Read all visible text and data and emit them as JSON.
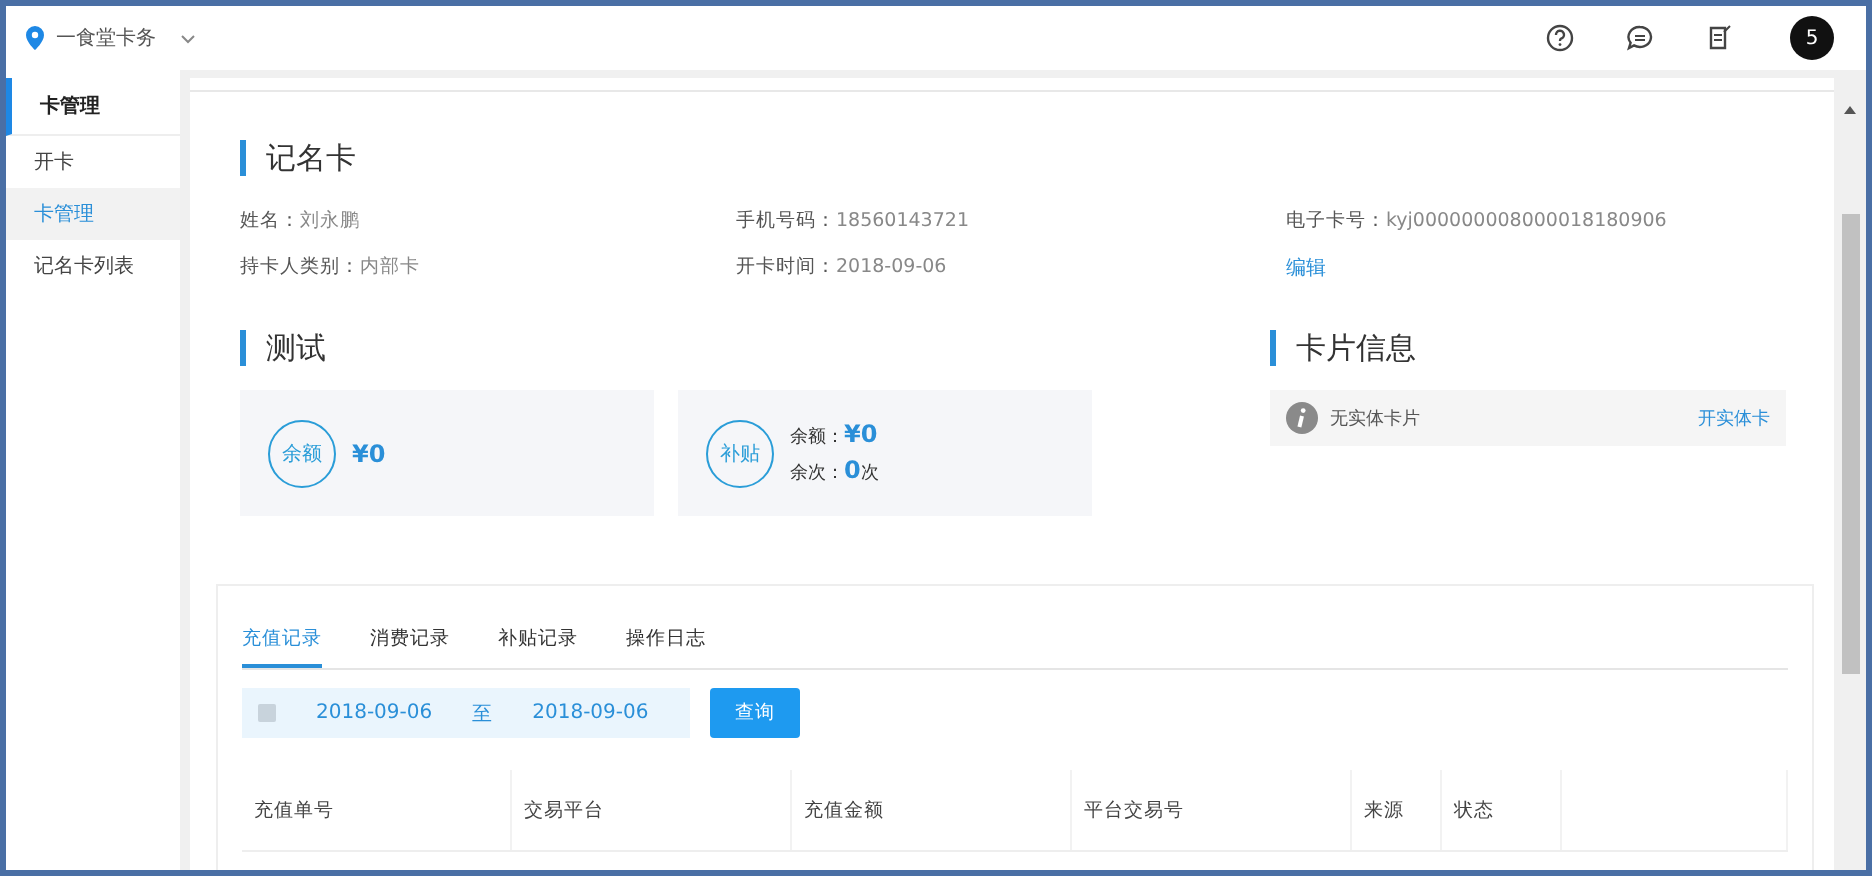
{
  "topbar": {
    "store": "一食堂卡务",
    "avatar": "5"
  },
  "sidebar": {
    "title": "卡管理",
    "items": [
      {
        "label": "开卡",
        "selected": false
      },
      {
        "label": "卡管理",
        "selected": true
      },
      {
        "label": "记名卡列表",
        "selected": false
      }
    ]
  },
  "card_section": {
    "title": "记名卡",
    "fields": [
      {
        "label": "姓名：",
        "value": "刘永鹏"
      },
      {
        "label": "手机号码：",
        "value": "18560143721"
      },
      {
        "label": "电子卡号：",
        "value": "kyj000000008000018180906"
      },
      {
        "label": "持卡人类别：",
        "value": "内部卡"
      },
      {
        "label": "开卡时间：",
        "value": "2018-09-06"
      }
    ],
    "edit_link": "编辑"
  },
  "account_section": {
    "title": "测试",
    "balance": {
      "badge": "余额",
      "amount": "¥0"
    },
    "subsidy": {
      "badge": "补贴",
      "rows": [
        {
          "label": "余额：",
          "value": "¥0",
          "unit": ""
        },
        {
          "label": "余次：",
          "value": "0",
          "unit": "次"
        }
      ]
    }
  },
  "card_info": {
    "title": "卡片信息",
    "message": "无实体卡片",
    "action": "开实体卡"
  },
  "records": {
    "tabs": [
      {
        "label": "充值记录",
        "selected": true
      },
      {
        "label": "消费记录",
        "selected": false
      },
      {
        "label": "补贴记录",
        "selected": false
      },
      {
        "label": "操作日志",
        "selected": false
      }
    ],
    "date_from": "2018-09-06",
    "date_sep": "至",
    "date_to": "2018-09-06",
    "query_button": "查询",
    "columns": [
      "充值单号",
      "交易平台",
      "充值金额",
      "平台交易号",
      "来源",
      "状态"
    ]
  }
}
